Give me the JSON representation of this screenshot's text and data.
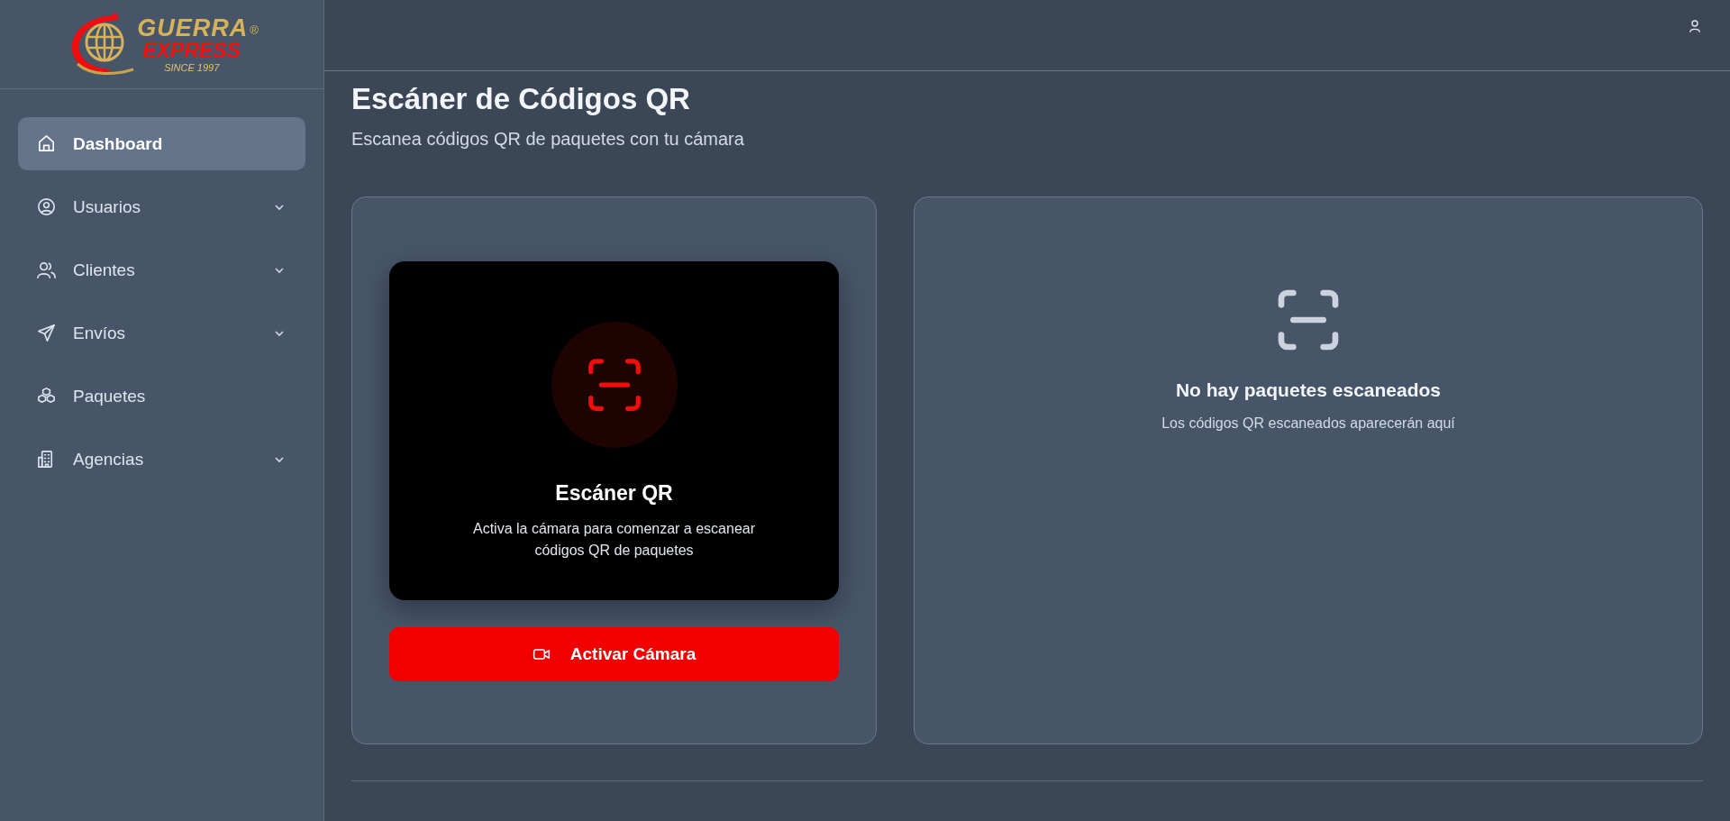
{
  "logo": {
    "name_top": "GUERRA",
    "name_bottom": "EXPRESS",
    "registered": "®",
    "tagline": "SINCE 1997"
  },
  "sidebar": {
    "items": [
      {
        "label": "Dashboard",
        "selected": true,
        "expandable": false
      },
      {
        "label": "Usuarios",
        "selected": false,
        "expandable": true
      },
      {
        "label": "Clientes",
        "selected": false,
        "expandable": true
      },
      {
        "label": "Envíos",
        "selected": false,
        "expandable": true
      },
      {
        "label": "Paquetes",
        "selected": false,
        "expandable": false
      },
      {
        "label": "Agencias",
        "selected": false,
        "expandable": true
      }
    ]
  },
  "page": {
    "title": "Escáner de Códigos QR",
    "subtitle": "Escanea códigos QR de paquetes con tu cámara"
  },
  "scanner": {
    "title": "Escáner QR",
    "description": "Activa la cámara para comenzar a escanear códigos QR de paquetes",
    "button": "Activar Cámara"
  },
  "results": {
    "title": "No hay paquetes escaneados",
    "description": "Los códigos QR escaneados aparecerán aquí"
  }
}
